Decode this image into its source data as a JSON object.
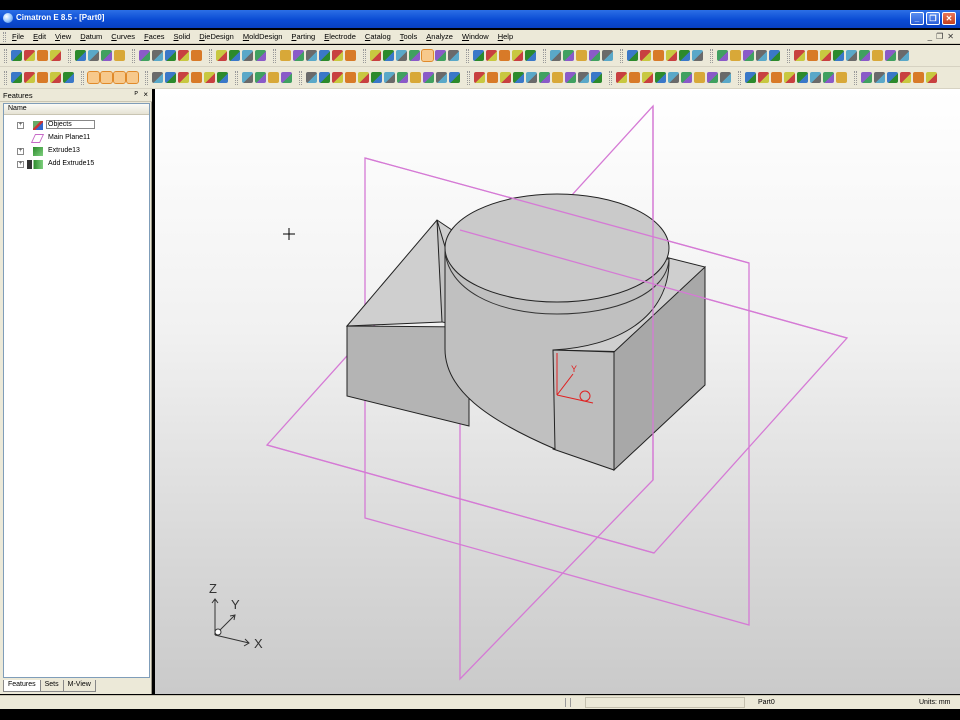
{
  "window": {
    "title": "Cimatron E 8.5 - [Part0]",
    "buttons": [
      "_",
      "❐",
      "✕"
    ]
  },
  "menu": [
    "File",
    "Edit",
    "View",
    "Datum",
    "Curves",
    "Faces",
    "Solid",
    "DieDesign",
    "MoldDesign",
    "Parting",
    "Electrode",
    "Catalog",
    "Tools",
    "Analyze",
    "Window",
    "Help"
  ],
  "mdi_buttons": [
    "_",
    "❐",
    "✕"
  ],
  "features_pane": {
    "title": "Features",
    "pin": "ᴾ",
    "close": "×",
    "column_header": "Name",
    "tree": [
      {
        "label": "Objects",
        "expander": "+",
        "icon": "objects-icon"
      },
      {
        "label": "Main Plane11",
        "expander": "",
        "icon": "plane-icon"
      },
      {
        "label": "Extrude13",
        "expander": "+",
        "icon": "extrude-icon"
      },
      {
        "label": "Add Extrude15",
        "expander": "+",
        "icon": "add-extrude-icon"
      }
    ],
    "tabs": [
      "Features",
      "Sets",
      "M-View"
    ],
    "active_tab": "Features"
  },
  "viewport": {
    "axis_labels": {
      "z": "Z",
      "y": "Y",
      "x": "X"
    },
    "colors": {
      "datum_plane": "#d57ad5",
      "triad_local": "#e02020",
      "model_face": "#c7c7c7"
    }
  },
  "status": {
    "file": "Part0",
    "units": "Units: mm"
  }
}
